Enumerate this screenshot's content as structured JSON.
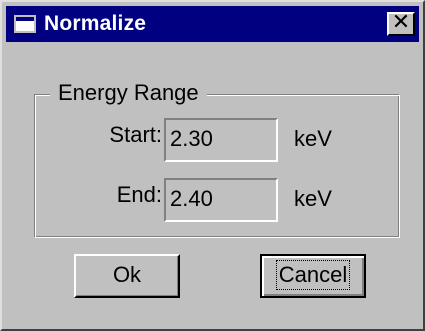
{
  "window": {
    "title": "Normalize",
    "close_glyph": "✕",
    "colors": {
      "titlebar": "#000080",
      "face": "#c0c0c0"
    }
  },
  "energy_range": {
    "group_label": "Energy Range",
    "start": {
      "label": "Start:",
      "value": "2.30",
      "unit": "keV"
    },
    "end": {
      "label": "End:",
      "value": "2.40",
      "unit": "keV"
    }
  },
  "buttons": {
    "ok_label": "Ok",
    "cancel_label": "Cancel"
  },
  "icons": {
    "title_icon": "window-icon",
    "close_icon": "close-icon"
  }
}
